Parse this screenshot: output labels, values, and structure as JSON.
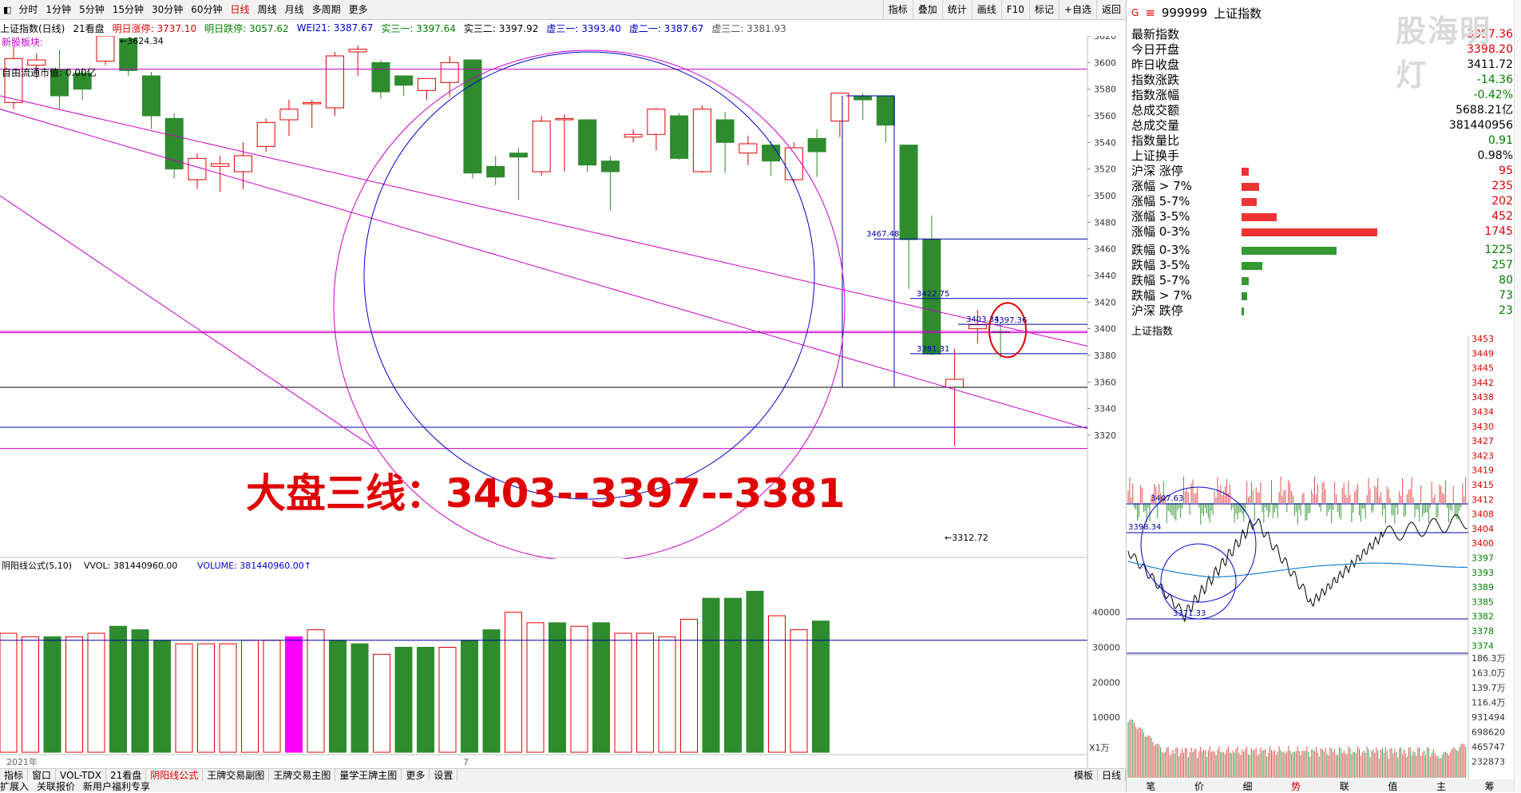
{
  "toolbar": {
    "period_tabs": [
      "分时",
      "1分钟",
      "5分钟",
      "15分钟",
      "30分钟",
      "60分钟",
      "日线",
      "周线",
      "月线",
      "多周期",
      "更多"
    ],
    "active_tab": "日线",
    "tool_buttons": [
      "指标",
      "叠加",
      "统计",
      "画线",
      "F10",
      "标记",
      "+自选",
      "返回"
    ]
  },
  "info": {
    "title": "上证指数(日线)",
    "mode": "21看盘",
    "limit_up": "明日涨停: 3737.10",
    "limit_down": "明日跌停: 3057.62",
    "wei21": "WEI21: 3387.67",
    "shi1": "实三一: 3397.64",
    "shi2": "实三二: 3397.92",
    "xu1": "虚三一: 3393.40",
    "xu2": "虚二一: 3387.67",
    "xu3": "虚三二: 3381.93"
  },
  "chart_overlay": {
    "top_label_1": "新股板块:",
    "top_label_2": "自由流通市值: 0.00亿",
    "high_marker": "3624.34",
    "low_marker": "3312.72",
    "headline": "大盘三线：3403--3397--3381",
    "line_labels": [
      "3467.48",
      "3422.75",
      "3403.34",
      "3397.36",
      "3381.31"
    ]
  },
  "price_axis": [
    "3620",
    "3600",
    "3580",
    "3560",
    "3540",
    "3520",
    "3500",
    "3480",
    "3460",
    "3440",
    "3420",
    "3400",
    "3380",
    "3360",
    "3340",
    "3320"
  ],
  "volume_panel": {
    "title": "阴阳线公式(5,10)",
    "vvol": "VVOL: 381440960.00",
    "volume": "VOLUME: 381440960.00",
    "axis": [
      "40000",
      "30000",
      "20000",
      "10000"
    ],
    "unit": "X1万",
    "date_left": "2021年",
    "date_mid": "7"
  },
  "bottom_tabs": [
    "指标",
    "窗口",
    "VOL-TDX",
    "21看盘",
    "阴阳线公式",
    "王牌交易副图",
    "王牌交易主图",
    "量学王牌主图",
    "更多",
    "设置"
  ],
  "bottom_active": "阴阳线公式",
  "bottom_right": [
    "模板",
    "日线"
  ],
  "status_bar": [
    "扩展入",
    "关联报价",
    "新用户福利专享"
  ],
  "quote": {
    "code": "999999",
    "name": "上证指数",
    "rows": [
      {
        "label": "最新指数",
        "value": "3397.36",
        "color": "#e00000"
      },
      {
        "label": "今日开盘",
        "value": "3398.20",
        "color": "#e00000"
      },
      {
        "label": "昨日收盘",
        "value": "3411.72",
        "color": "#000000"
      },
      {
        "label": "指数涨跌",
        "value": "-14.36",
        "color": "#008000"
      },
      {
        "label": "指数涨幅",
        "value": "-0.42%",
        "color": "#008000"
      },
      {
        "label": "总成交额",
        "value": "5688.21亿",
        "color": "#000000"
      },
      {
        "label": "总成交量",
        "value": "381440956",
        "color": "#000000"
      },
      {
        "label": "指数量比",
        "value": "0.91",
        "color": "#008000"
      },
      {
        "label": "上证换手",
        "value": "0.98%",
        "color": "#000000"
      }
    ],
    "distribution": [
      {
        "label": "沪深 涨停",
        "value": "95",
        "ratio": 0.05,
        "color": "#ee3333"
      },
      {
        "label": "涨幅 > 7%",
        "value": "235",
        "ratio": 0.13,
        "color": "#ee3333"
      },
      {
        "label": "涨幅 5-7%",
        "value": "202",
        "ratio": 0.11,
        "color": "#ee3333"
      },
      {
        "label": "涨幅 3-5%",
        "value": "452",
        "ratio": 0.26,
        "color": "#ee3333"
      },
      {
        "label": "涨幅 0-3%",
        "value": "1745",
        "ratio": 1.0,
        "color": "#ee3333"
      },
      {
        "label": "跌幅 0-3%",
        "value": "1225",
        "ratio": 0.7,
        "color": "#339933"
      },
      {
        "label": "跌幅 3-5%",
        "value": "257",
        "ratio": 0.15,
        "color": "#339933"
      },
      {
        "label": "跌幅 5-7%",
        "value": "80",
        "ratio": 0.05,
        "color": "#339933"
      },
      {
        "label": "跌幅 > 7%",
        "value": "73",
        "ratio": 0.04,
        "color": "#339933"
      },
      {
        "label": "沪深 跌停",
        "value": "23",
        "ratio": 0.015,
        "color": "#339933"
      }
    ]
  },
  "intraday": {
    "title": "上证指数",
    "price_axis": [
      "3453",
      "3449",
      "3445",
      "3442",
      "3438",
      "3434",
      "3430",
      "3427",
      "3423",
      "3419",
      "3415",
      "3412",
      "3408",
      "3404",
      "3400",
      "3397",
      "3393",
      "3389",
      "3385",
      "3382",
      "3378",
      "3374"
    ],
    "vol_axis": [
      "186.3万",
      "163.0万",
      "139.7万",
      "116.4万",
      "931494",
      "698620",
      "465747",
      "232873"
    ],
    "labels": [
      "3407.63",
      "3398.34",
      "3371.33"
    ],
    "bottom_tabs": [
      "笔",
      "价",
      "细",
      "势",
      "联",
      "值",
      "主",
      "筹"
    ]
  },
  "watermark": "股海明灯"
}
